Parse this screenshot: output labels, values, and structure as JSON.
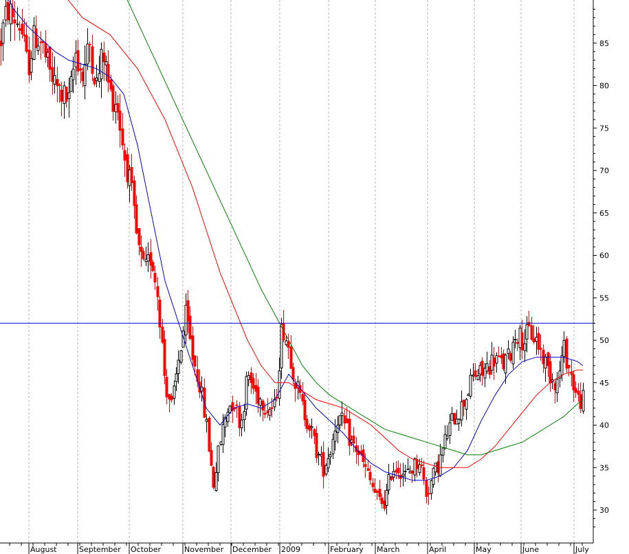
{
  "chart_data": {
    "type": "line",
    "style": "candlestick",
    "title": "",
    "xlabel": "",
    "ylabel": "",
    "ylim": [
      27,
      90
    ],
    "y_axis_position": "right",
    "y_ticks": [
      30,
      35,
      40,
      45,
      50,
      55,
      60,
      65,
      70,
      75,
      80,
      85
    ],
    "x_ticks": [
      "August",
      "September",
      "October",
      "November",
      "December",
      "2009",
      "February",
      "March",
      "April",
      "May",
      "June",
      "July"
    ],
    "grid": "vertical dashed at month starts",
    "colors": {
      "up_candle": "#000000",
      "down_candle": "#ff0000",
      "ma_short": "#0000cc",
      "ma_mid": "#ff0000",
      "ma_long": "#008000",
      "resistance": "#0000cc",
      "grid": "#b5b5b5"
    },
    "resistance_level": 52,
    "price_path": {
      "x": [
        0,
        10,
        20,
        30,
        40,
        50,
        60,
        70,
        80,
        90,
        100,
        110,
        120,
        130,
        140,
        150,
        160,
        170,
        180,
        190,
        200,
        210,
        220,
        230,
        240,
        250,
        260,
        270,
        280,
        290,
        300,
        310,
        320,
        330,
        340,
        350,
        360,
        370,
        380,
        390,
        400,
        410,
        420,
        430,
        440,
        450,
        460,
        470,
        480,
        490,
        500,
        510,
        520,
        530,
        540,
        550,
        560,
        570,
        580,
        590,
        600,
        610,
        620,
        630,
        640,
        650,
        660,
        670,
        680,
        690,
        700,
        710,
        720,
        730,
        740,
        750,
        760,
        770,
        780,
        790,
        800,
        810,
        820,
        830,
        840,
        848
      ],
      "y": [
        85,
        89,
        88,
        87,
        82,
        86,
        85,
        82,
        80,
        79,
        78,
        84,
        81,
        85,
        80,
        84,
        79,
        78,
        72,
        68,
        61,
        58,
        60,
        55,
        45,
        42,
        48,
        53,
        48,
        45,
        40,
        33,
        38,
        42,
        43,
        40,
        46,
        44,
        43,
        42,
        42,
        52,
        49,
        45,
        42,
        40,
        37,
        35,
        37,
        41,
        40,
        38,
        37,
        35,
        33,
        31,
        31,
        35,
        35,
        34,
        35,
        36,
        32,
        34,
        36,
        39,
        41,
        42,
        44,
        46,
        46,
        47,
        48,
        47,
        48,
        51,
        50,
        51,
        50,
        48,
        46,
        45,
        49,
        46,
        43,
        43
      ]
    },
    "series": [
      {
        "name": "",
        "color": "#0000cc",
        "x": [
          0,
          20,
          40,
          60,
          80,
          100,
          120,
          140,
          160,
          180,
          200,
          220,
          240,
          260,
          280,
          300,
          320,
          340,
          360,
          380,
          400,
          420,
          440,
          460,
          480,
          500,
          520,
          540,
          560,
          580,
          600,
          620,
          640,
          660,
          680,
          700,
          720,
          740,
          760,
          780,
          800,
          820,
          840,
          848
        ],
        "values": [
          92,
          89,
          87,
          85.5,
          84,
          83,
          82.5,
          82,
          81,
          79,
          73,
          65,
          57,
          52,
          47,
          42,
          40,
          42,
          42.5,
          42,
          43,
          46,
          44,
          42,
          40.5,
          39,
          37,
          35.5,
          34.5,
          34,
          33.5,
          33.5,
          34,
          35,
          37,
          40.5,
          43.5,
          46,
          47.5,
          48,
          48,
          48,
          47.5,
          47
        ]
      },
      {
        "name": "",
        "color": "#ff0000",
        "x": [
          0,
          40,
          80,
          120,
          160,
          200,
          240,
          280,
          320,
          360,
          380,
          400,
          420,
          440,
          460,
          480,
          500,
          520,
          540,
          560,
          580,
          600,
          620,
          640,
          660,
          680,
          700,
          720,
          740,
          760,
          780,
          800,
          820,
          840,
          848
        ],
        "values": [
          100,
          96,
          92,
          88,
          86,
          82,
          76,
          68,
          58,
          50,
          47,
          45,
          45,
          44,
          43,
          42.5,
          42,
          41,
          40,
          38.5,
          37,
          36,
          35.5,
          35,
          35,
          35,
          36,
          37.5,
          39.5,
          41.5,
          43.5,
          45,
          46,
          46.5,
          46.5
        ]
      },
      {
        "name": "",
        "color": "#008000",
        "x": [
          100,
          140,
          180,
          220,
          260,
          300,
          340,
          380,
          400,
          420,
          440,
          460,
          480,
          500,
          520,
          540,
          560,
          580,
          600,
          620,
          640,
          660,
          680,
          700,
          720,
          740,
          760,
          780,
          800,
          820,
          840,
          848
        ],
        "values": [
          100,
          96,
          91,
          84,
          77,
          70,
          63,
          56,
          53,
          50,
          47,
          45,
          43.5,
          42.5,
          41.5,
          40.5,
          39.5,
          39,
          38.5,
          38,
          37.5,
          37,
          36.5,
          36.5,
          37,
          37.5,
          38,
          39,
          40,
          41,
          42.5,
          43
        ]
      }
    ]
  }
}
